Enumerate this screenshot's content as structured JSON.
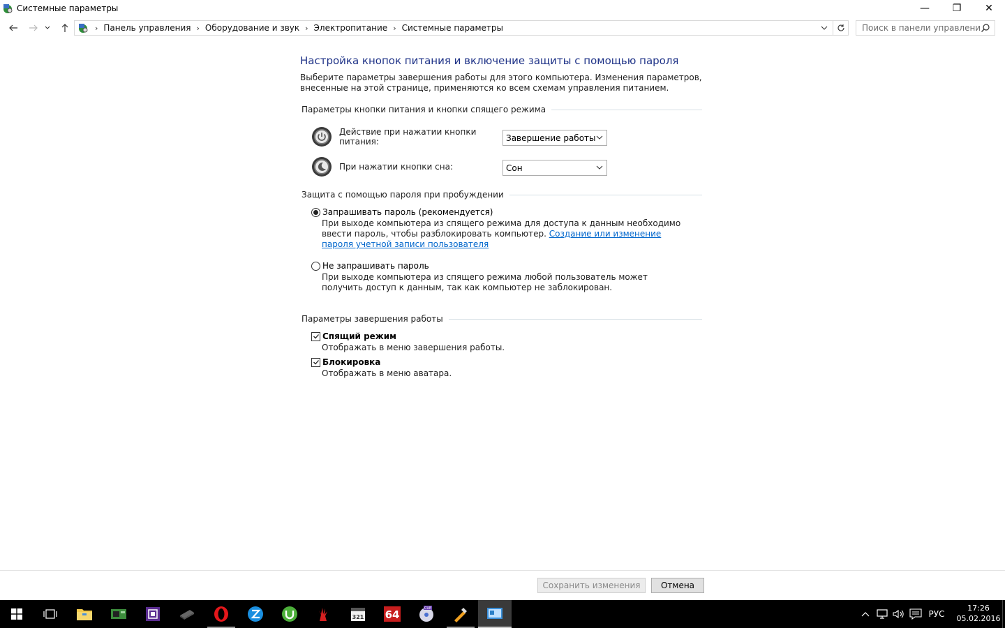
{
  "window": {
    "title": "Системные параметры",
    "minimize": "—",
    "restore": "❐",
    "close": "✕"
  },
  "nav": {
    "breadcrumbs": [
      "Панель управления",
      "Оборудование и звук",
      "Электропитание",
      "Системные параметры"
    ],
    "search_placeholder": "Поиск в панели управления"
  },
  "page": {
    "heading": "Настройка кнопок питания и включение защиты с помощью пароля",
    "intro": "Выберите параметры завершения работы для этого компьютера. Изменения параметров, внесенные на этой странице, применяются ко всем схемам управления питанием.",
    "power_group": {
      "title": "Параметры кнопки питания и кнопки спящего режима",
      "power_button_label": "Действие при нажатии кнопки питания:",
      "power_button_value": "Завершение работы",
      "sleep_button_label": "При нажатии кнопки сна:",
      "sleep_button_value": "Сон"
    },
    "password_group": {
      "title": "Защита с помощью пароля при пробуждении",
      "require_label": "Запрашивать пароль (рекомендуется)",
      "require_desc": "При выходе компьютера из спящего режима для доступа к данным необходимо ввести пароль, чтобы разблокировать компьютер.",
      "require_link": "Создание или изменение пароля учетной записи пользователя",
      "require_checked": true,
      "norequire_label": "Не запрашивать пароль",
      "norequire_desc": "При выходе компьютера из спящего режима любой пользователь может получить доступ к данным, так как компьютер не заблокирован.",
      "norequire_checked": false
    },
    "shutdown_group": {
      "title": "Параметры завершения работы",
      "sleep_label": "Спящий режим",
      "sleep_desc": "Отображать в меню завершения работы.",
      "sleep_checked": true,
      "lock_label": "Блокировка",
      "lock_desc": "Отображать в меню аватара.",
      "lock_checked": true
    }
  },
  "footer": {
    "save_label": "Сохранить изменения",
    "cancel_label": "Отмена"
  },
  "taskbar": {
    "apps": [
      "start",
      "task-view",
      "file-explorer",
      "gpu-z",
      "cpu-z",
      "memory-app",
      "opera",
      "zona",
      "utorrent",
      "bloody",
      "calendar-app",
      "aida64",
      "cue-disc",
      "tools-app",
      "control-panel"
    ],
    "aida_text": "64",
    "calendar_text": "321",
    "cue_text": "CUE",
    "language": "РУС",
    "time": "17:26",
    "date": "05.02.2016"
  },
  "colors": {
    "heading": "#1e3287",
    "link": "#0066cc",
    "taskbar": "#000000"
  }
}
